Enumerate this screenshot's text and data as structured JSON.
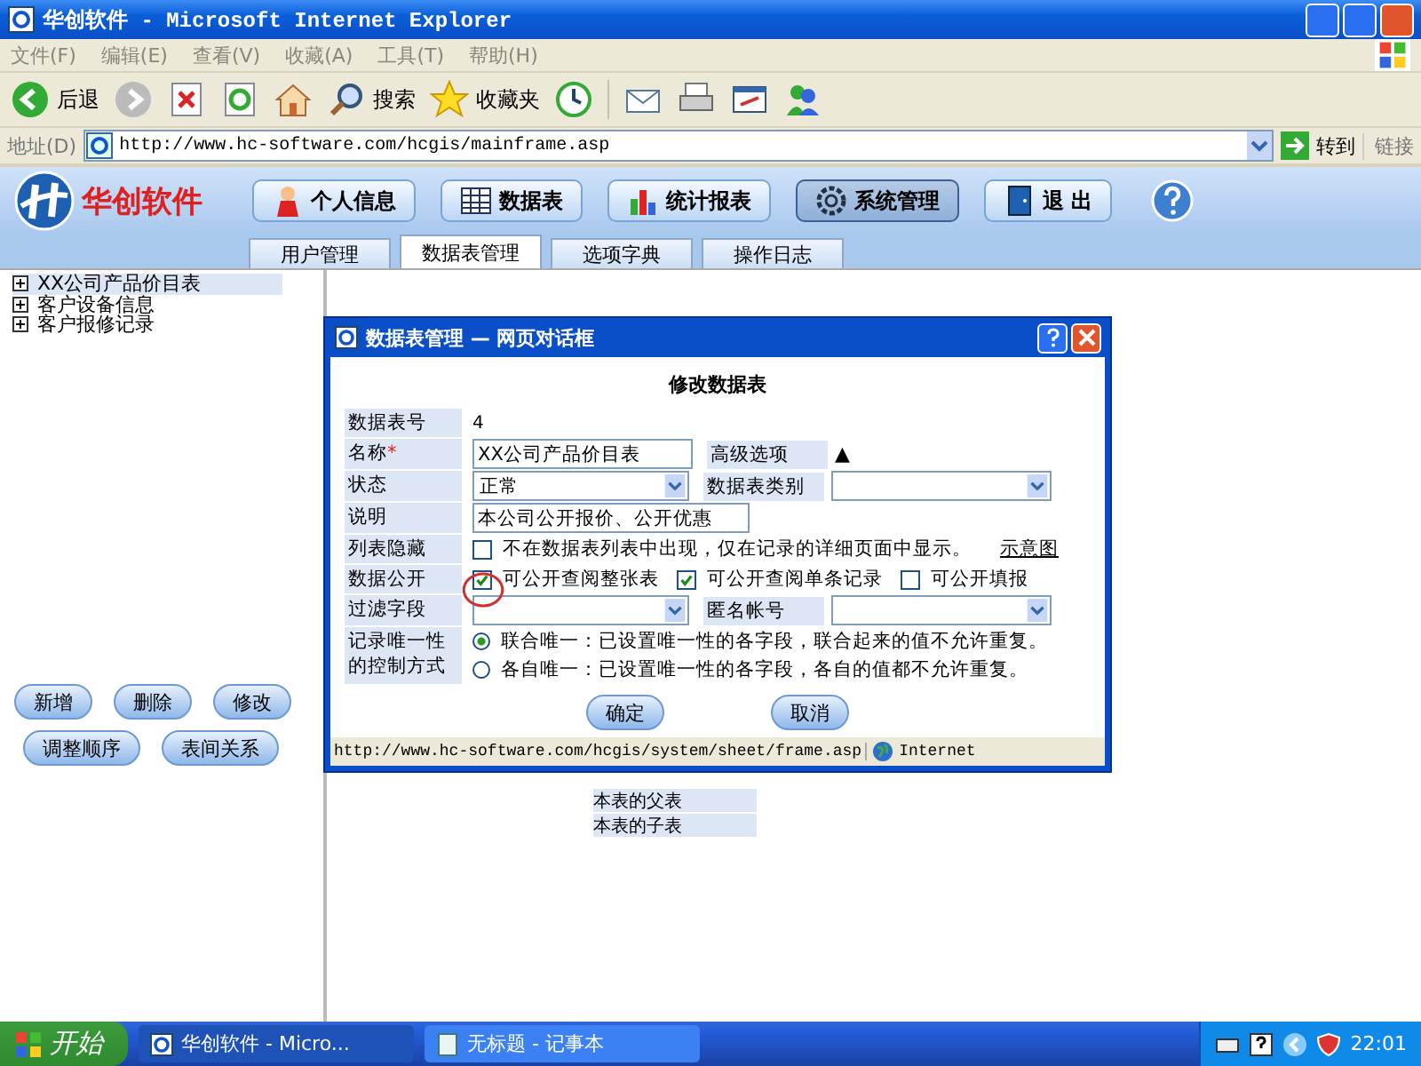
{
  "window": {
    "title": "华创软件 - Microsoft Internet Explorer"
  },
  "menu": [
    "文件(F)",
    "编辑(E)",
    "查看(V)",
    "收藏(A)",
    "工具(T)",
    "帮助(H)"
  ],
  "toolbar": {
    "back": "后退",
    "search": "搜索",
    "favorites": "收藏夹"
  },
  "address": {
    "label": "地址(D)",
    "url": "http://www.hc-software.com/hcgis/mainframe.asp",
    "go": "转到",
    "links": "链接"
  },
  "app": {
    "logo": "华创软件",
    "nav": [
      {
        "label": "个人信息",
        "selected": false
      },
      {
        "label": "数据表",
        "selected": false
      },
      {
        "label": "统计报表",
        "selected": false
      },
      {
        "label": "系统管理",
        "selected": true
      },
      {
        "label": "退 出",
        "selected": false
      }
    ],
    "tabs": [
      {
        "label": "用户管理",
        "selected": false
      },
      {
        "label": "数据表管理",
        "selected": true
      },
      {
        "label": "选项字典",
        "selected": false
      },
      {
        "label": "操作日志",
        "selected": false
      }
    ]
  },
  "sidebar": {
    "tree": [
      {
        "label": "XX公司产品价目表",
        "selected": true,
        "expanded": false
      },
      {
        "label": "客户设备信息",
        "selected": false,
        "expanded": false
      },
      {
        "label": "客户报修记录",
        "selected": false,
        "expanded": false
      }
    ],
    "buttons": [
      [
        "新增",
        "删除",
        "修改"
      ],
      [
        "调整顺序",
        "表间关系"
      ]
    ]
  },
  "background_table": {
    "rows": [
      "本表的父表",
      "本表的子表"
    ]
  },
  "dialog": {
    "title": "数据表管理 — 网页对话框",
    "heading": "修改数据表",
    "rows": [
      {
        "kind": "text",
        "label": "数据表号",
        "value": "4"
      },
      {
        "kind": "input",
        "label": "名称",
        "mark": "*",
        "value": "XX公司产品价目表",
        "side_label": "高级选项",
        "side_value": "▲"
      },
      {
        "kind": "select",
        "label": "状态",
        "value": "正常",
        "side_label": "数据表类别",
        "side_select": ""
      },
      {
        "kind": "input",
        "label": "说明",
        "value": "本公司公开报价、公开优惠"
      },
      {
        "kind": "checks",
        "label": "列表隐藏",
        "options": [
          {
            "label": "不在数据表列表中出现，仅在记录的详细页面中显示。",
            "checked": false
          }
        ],
        "link": "示意图"
      },
      {
        "kind": "checks",
        "label": "数据公开",
        "options": [
          {
            "label": "可公开查阅整张表",
            "checked": true
          },
          {
            "label": "可公开查阅单条记录",
            "checked": true
          },
          {
            "label": "可公开填报",
            "checked": false
          }
        ]
      },
      {
        "kind": "select",
        "label": "过滤字段",
        "value": "",
        "side_label": "匿名帐号",
        "side_select": ""
      },
      {
        "kind": "radios",
        "label": "记录唯一性的控制方式",
        "options": [
          {
            "label": "联合唯一：已设置唯一性的各字段，联合起来的值不允许重复。",
            "selected": true
          },
          {
            "label": "各自唯一：已设置唯一性的各字段，各自的值都不允许重复。",
            "selected": false
          }
        ]
      }
    ],
    "buttons": [
      "确定",
      "取消"
    ],
    "status_url": "http://www.hc-software.com/hcgis/system/sheet/frame.asp",
    "zone": "Internet"
  },
  "taskbar": {
    "start": "开始",
    "tasks": [
      {
        "label": "华创软件 - Micro...",
        "selected": true
      },
      {
        "label": "无标题 - 记事本",
        "selected": false
      }
    ],
    "clock": "22:01"
  }
}
